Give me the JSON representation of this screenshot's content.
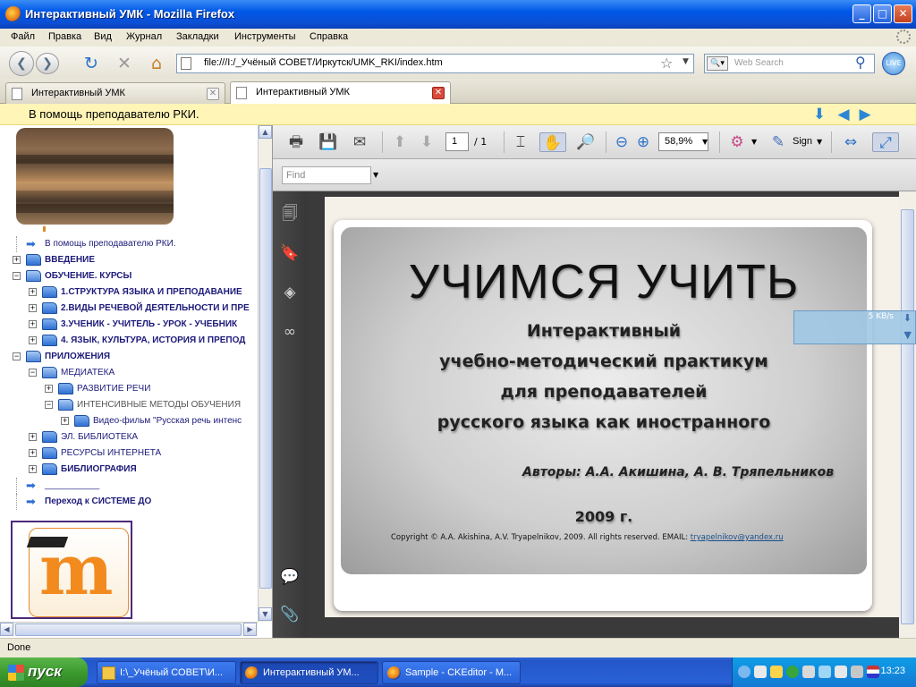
{
  "window": {
    "title": "Интерактивный УМК - Mozilla Firefox",
    "min": "_",
    "max": "□",
    "close": "✕"
  },
  "menu": [
    "Файл",
    "Правка",
    "Вид",
    "Журнал",
    "Закладки",
    "Инструменты",
    "Справка"
  ],
  "nav": {
    "url": "file:///I:/_Учёный СОВЕТ/Иркутск/UMK_RKI/index.htm",
    "search_placeholder": "Web Search",
    "addon": "LIVE"
  },
  "tabs": [
    {
      "label": "Интерактивный УМК",
      "active": false
    },
    {
      "label": "Интерактивный УМК",
      "active": true
    }
  ],
  "header": {
    "text": "В помощь преподавателю РКИ."
  },
  "tree": [
    {
      "label": "В помощь преподавателю РКИ.",
      "level": 0,
      "type": "arrow",
      "bold": false
    },
    {
      "label": "ВВЕДЕНИЕ",
      "level": 0,
      "type": "folder",
      "expand": "+",
      "bold": true
    },
    {
      "label": "ОБУЧЕНИЕ. КУРСЫ",
      "level": 0,
      "type": "folder-open",
      "expand": "−",
      "bold": true
    },
    {
      "label": "1.СТРУКТУРА ЯЗЫКА И ПРЕПОДАВАНИЕ",
      "level": 1,
      "type": "folder",
      "expand": "+",
      "bold": true
    },
    {
      "label": "2.ВИДЫ РЕЧЕВОЙ ДЕЯТЕЛЬНОСТИ И ПРЕ",
      "level": 1,
      "type": "folder",
      "expand": "+",
      "bold": true
    },
    {
      "label": "3.УЧЕНИК - УЧИТЕЛЬ - УРОК - УЧЕБНИК",
      "level": 1,
      "type": "folder",
      "expand": "+",
      "bold": true
    },
    {
      "label": "4. ЯЗЫК, КУЛЬТУРА, ИСТОРИЯ И ПРЕПОД",
      "level": 1,
      "type": "folder",
      "expand": "+",
      "bold": true
    },
    {
      "label": "ПРИЛОЖЕНИЯ",
      "level": 0,
      "type": "folder-open",
      "expand": "−",
      "bold": true
    },
    {
      "label": "МЕДИАТЕКА",
      "level": 1,
      "type": "folder-open",
      "expand": "−",
      "bold": false
    },
    {
      "label": "РАЗВИТИЕ РЕЧИ",
      "level": 2,
      "type": "folder",
      "expand": "+",
      "bold": false
    },
    {
      "label": "ИНТЕНСИВНЫЕ МЕТОДЫ ОБУЧЕНИЯ",
      "level": 2,
      "type": "folder-open",
      "expand": "−",
      "bold": false,
      "gray": true
    },
    {
      "label": "Видео-фильм \"Русская речь интенс",
      "level": 3,
      "type": "folder",
      "expand": "+",
      "bold": false
    },
    {
      "label": "ЭЛ. БИБЛИОТЕКА",
      "level": 1,
      "type": "folder",
      "expand": "+",
      "bold": false
    },
    {
      "label": "РЕСУРСЫ ИНТЕРНЕТА",
      "level": 1,
      "type": "folder",
      "expand": "+",
      "bold": false
    },
    {
      "label": "БИБЛИОГРАФИЯ",
      "level": 1,
      "type": "folder",
      "expand": "+",
      "bold": true
    },
    {
      "label": "___________",
      "level": 0,
      "type": "arrow",
      "bold": false
    },
    {
      "label": "Переход к СИСТЕМЕ ДО",
      "level": 0,
      "type": "arrow",
      "bold": true
    }
  ],
  "pdf": {
    "page_current": "1",
    "page_total": "/ 1",
    "zoom": "58,9%",
    "sign_label": "Sign",
    "find_placeholder": "Find"
  },
  "slide": {
    "title": "УЧИМСЯ УЧИТЬ",
    "lines": [
      "Интерактивный",
      "учебно-методический практикум",
      "для преподавателей",
      "русского языка как иностранного"
    ],
    "authors": "Авторы: А.А. Акишина, А. В. Тряпельников",
    "year": "2009 г.",
    "copyright": "Copyright © A.A.  Akishina, A.V. Tryapelnikov, 2009. All rights reserved. EMAIL: ",
    "email": "tryapelnikov@yandex.ru"
  },
  "download": {
    "speed": "5 KB/s"
  },
  "status": "Done",
  "taskbar": {
    "start": "пуск",
    "tasks": [
      {
        "label": "I:\\_Учёный СОВЕТ\\И...",
        "active": false
      },
      {
        "label": "Интерактивный УМ...",
        "active": true
      },
      {
        "label": "Sample - CKEditor - M...",
        "active": false
      }
    ],
    "clock": "13:23"
  },
  "colors": {
    "accent": "#0058e6",
    "header_bg": "#fef5b6",
    "tree_text": "#1d1a7a",
    "moodle_orange": "#f28a1e"
  }
}
